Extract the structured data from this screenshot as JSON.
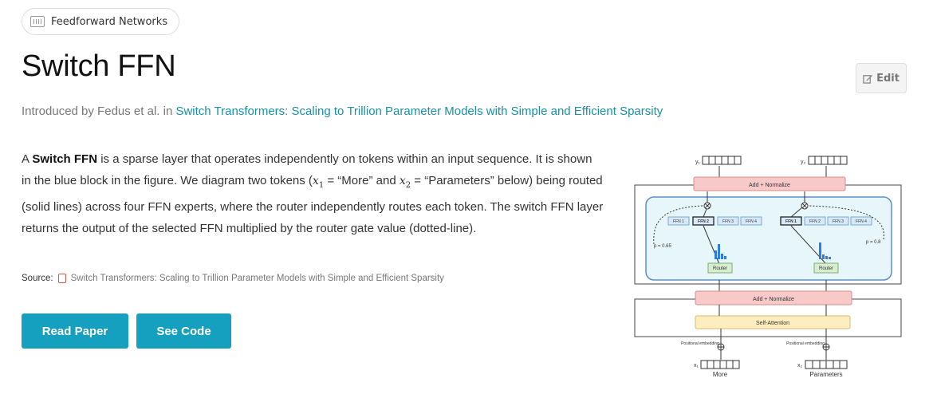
{
  "tag": {
    "label": "Feedforward Networks",
    "icon": "barcode-icon"
  },
  "title": "Switch FFN",
  "edit": {
    "label": "Edit",
    "icon": "edit-icon"
  },
  "intro": {
    "prefix": "Introduced by Fedus et al. in ",
    "paper_title": "Switch Transformers: Scaling to Trillion Parameter Models with Simple and Efficient Sparsity"
  },
  "description": {
    "p1_a": "A ",
    "p1_bold": "Switch FFN",
    "p1_b": " is a sparse layer that operates independently on tokens within an input sequence. It is shown in the blue block in the figure. We diagram two tokens (",
    "x1_var": "x",
    "x1_sub": "1",
    "p1_c": " = “More” and ",
    "x2_var": "x",
    "x2_sub": "2",
    "p1_d": " = “Parameters” below) being routed (solid lines) across four FFN experts, where the router independently routes each token. The switch FFN layer returns the output of the selected FFN multiplied by the router gate value (dotted-line)."
  },
  "source": {
    "label": "Source:",
    "link": "Switch Transformers: Scaling to Trillion Parameter Models with Simple and Efficient Sparsity"
  },
  "buttons": {
    "read_paper": "Read Paper",
    "see_code": "See Code"
  },
  "figure": {
    "y1": "y₁",
    "y2": "y₂",
    "x1": "x₁",
    "x2": "x₂",
    "add_normalize_top": "Add + Normalize",
    "add_normalize_bottom": "Add + Normalize",
    "self_attention": "Self-Attention",
    "ffn_left": [
      "FFN 1",
      "FFN 2",
      "FFN 3",
      "FFN 4"
    ],
    "ffn_right": [
      "FFN 1",
      "FFN 2",
      "FFN 3",
      "FFN 4"
    ],
    "p_left": "p = 0.65",
    "p_right": "p = 0.8",
    "router_left": "Router",
    "router_right": "Router",
    "pos_emb_left": "Positional embedding",
    "pos_emb_right": "Positional embedding",
    "token_left": "More",
    "token_right": "Parameters",
    "colors": {
      "accent": "#14a0be",
      "add_norm": "#f7c9c9",
      "attention": "#fdeec2",
      "switch_block": "#e6f6fb",
      "router": "#d8ecd0"
    }
  }
}
